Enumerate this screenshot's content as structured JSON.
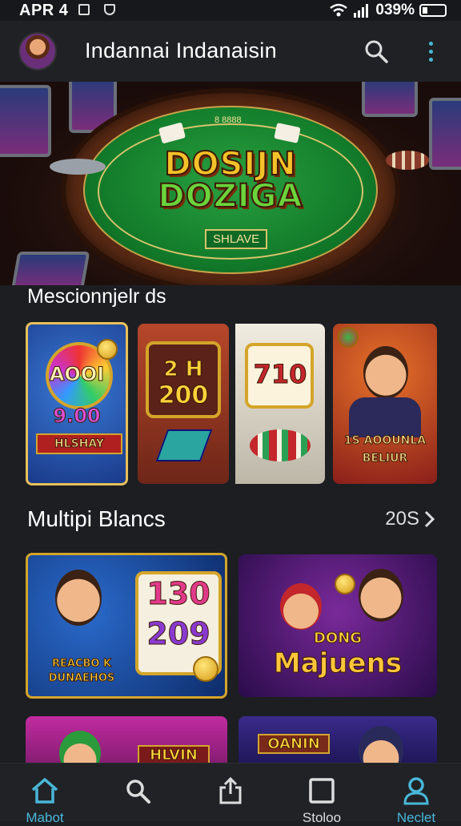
{
  "status_bar": {
    "time": "APR 4",
    "battery_percent": "039%"
  },
  "header": {
    "title": "Indannai Indanaisin"
  },
  "hero": {
    "logo_line1": "DOSIJN",
    "logo_line2": "DOZIGA",
    "felt_badge": "SHLAVE",
    "felt_cards_text": "8 8888"
  },
  "section1": {
    "title": "Mescionnjelr ds",
    "tiles": [
      {
        "line1": "AOOI",
        "line2": "9.00",
        "banner": "HLSHAY"
      },
      {
        "line1": "2 H",
        "line2": "200"
      },
      {
        "line1": "710"
      },
      {
        "line1": "1S AOOUNLA",
        "line2": "BELIUR"
      }
    ]
  },
  "section2": {
    "title": "Multipi Blancs",
    "see_all": "20S",
    "tiles": [
      {
        "line1": "130",
        "line2": "209",
        "caption1": "REACBO K",
        "caption2": "DUNAEHOS"
      },
      {
        "line1": "DONG",
        "line2": "Majuens"
      }
    ],
    "partial_tiles": [
      {
        "line1": "HLVIN"
      },
      {
        "line1": "OANIN"
      }
    ]
  },
  "bottom_nav": [
    {
      "label": "Mabot",
      "icon": "home-icon",
      "active": true
    },
    {
      "label": "",
      "icon": "search-icon",
      "active": false
    },
    {
      "label": "",
      "icon": "share-icon",
      "active": false
    },
    {
      "label": "Stoloo",
      "icon": "square-icon",
      "active": false
    },
    {
      "label": "Neclet",
      "icon": "profile-icon",
      "active": true
    }
  ],
  "colors": {
    "accent": "#49b7d8",
    "background": "#1c1e22",
    "felt": "#137d2b"
  }
}
